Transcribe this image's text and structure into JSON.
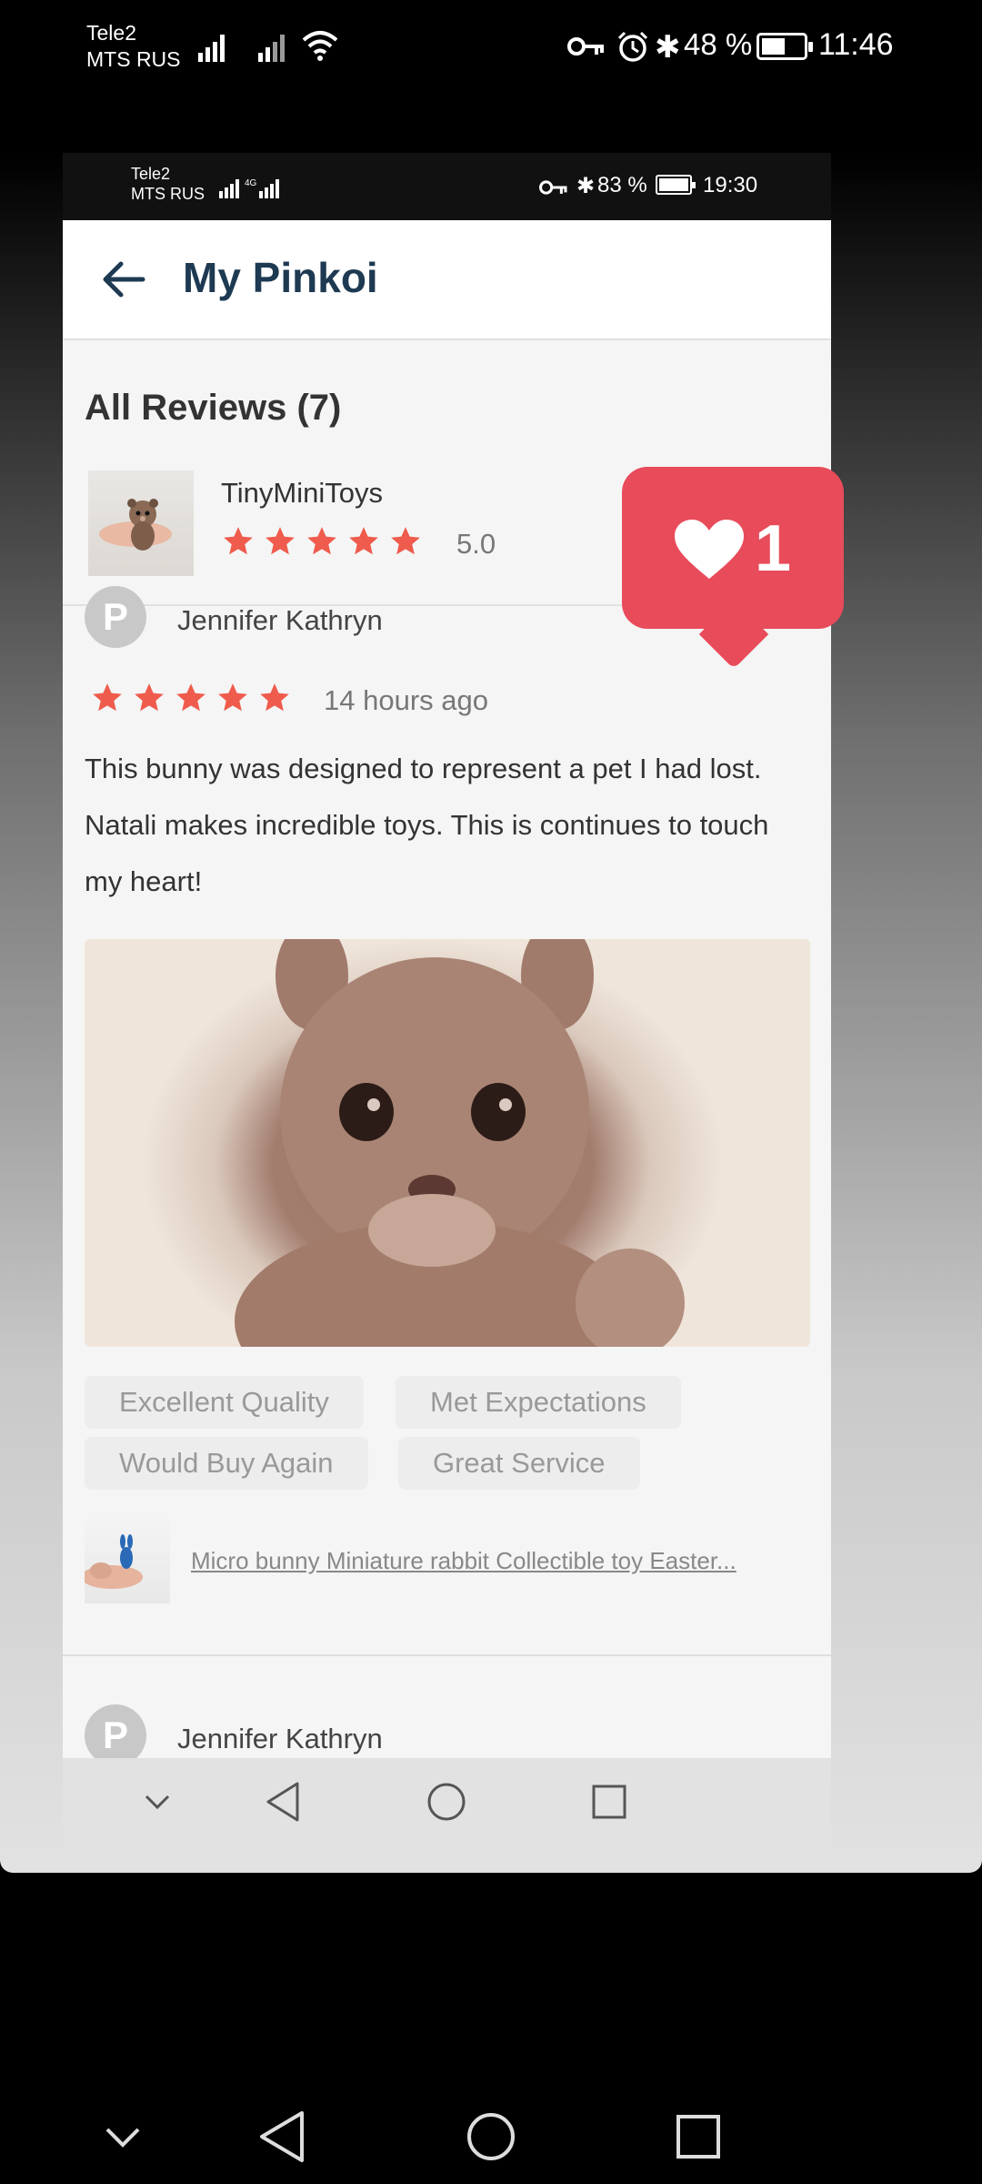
{
  "outer_status": {
    "carrier_1": "Tele2",
    "carrier_2": "MTS RUS",
    "battery": "48 %",
    "time": "11:46"
  },
  "inner_status": {
    "carrier_1": "Tele2",
    "carrier_2": "MTS RUS",
    "battery": "83 %",
    "time": "19:30"
  },
  "app": {
    "title": "My Pinkoi",
    "back_icon": "arrow-left-icon"
  },
  "reviews": {
    "heading": "All Reviews (7)",
    "shop": {
      "name": "TinyMiniToys",
      "rating": "5.0",
      "stars": 5
    },
    "items": [
      {
        "author": "Jennifer Kathryn",
        "stars": 5,
        "time": "14 hours ago",
        "text": "This bunny was designed to represent a pet I had lost. Natali makes incredible toys. This is continues to touch my heart!",
        "tags": [
          "Excellent Quality",
          "Met Expectations",
          "Would Buy Again",
          "Great Service"
        ],
        "product": "Micro bunny Miniature rabbit Collectible toy Easter..."
      },
      {
        "author": "Jennifer Kathryn"
      }
    ]
  },
  "like_badge": {
    "count": "1",
    "icon": "heart-icon",
    "color": "#e84b5a"
  },
  "colors": {
    "star": "#ef5b4c",
    "title": "#1e3a52"
  }
}
